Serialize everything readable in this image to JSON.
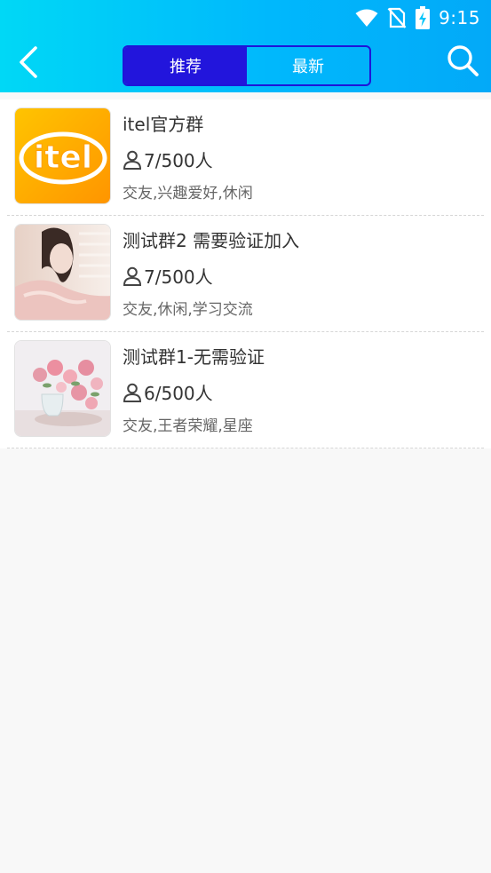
{
  "status_bar": {
    "time": "9:15",
    "icons": [
      "wifi-icon",
      "no-signal-icon",
      "battery-charging-icon"
    ]
  },
  "header": {
    "back_icon": "chevron-left-icon",
    "search_icon": "search-icon",
    "tabs": [
      {
        "label": "推荐",
        "active": true
      },
      {
        "label": "最新",
        "active": false
      }
    ],
    "colors": {
      "gradient_start": "#00d8f6",
      "gradient_end": "#03a9f8",
      "tab_active": "#2215dc"
    }
  },
  "groups": [
    {
      "name": "itel官方群",
      "members": "7/500人",
      "tags": "交友,兴趣爱好,休闲",
      "avatar": "itel-logo"
    },
    {
      "name": "测试群2 需要验证加入",
      "members": "7/500人",
      "tags": "交友,休闲,学习交流",
      "avatar": "woman-photo"
    },
    {
      "name": "测试群1-无需验证",
      "members": "6/500人",
      "tags": "交友,王者荣耀,星座",
      "avatar": "roses-photo"
    }
  ]
}
